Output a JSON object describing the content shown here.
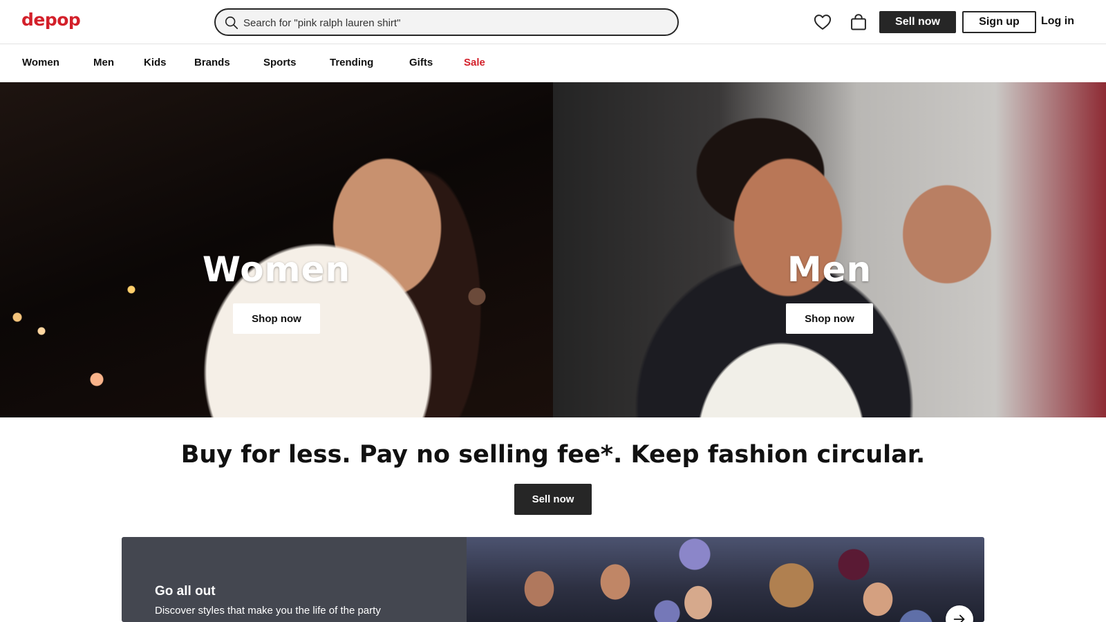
{
  "header": {
    "logo": "depop",
    "search_placeholder": "Search for \"pink ralph lauren shirt\"",
    "sell_label": "Sell now",
    "signup_label": "Sign up",
    "login_label": "Log in",
    "icons": [
      "search-icon",
      "heart-icon",
      "bag-icon"
    ]
  },
  "nav": {
    "items": [
      {
        "label": "Women"
      },
      {
        "label": "Men"
      },
      {
        "label": "Kids"
      },
      {
        "label": "Brands"
      },
      {
        "label": "Sports"
      },
      {
        "label": "Trending"
      },
      {
        "label": "Gifts"
      },
      {
        "label": "Sale"
      }
    ],
    "sale_color": "#d3202a"
  },
  "hero": {
    "women": {
      "title": "Women",
      "cta": "Shop now"
    },
    "men": {
      "title": "Men",
      "cta": "Shop now"
    }
  },
  "tagline": {
    "text": "Buy for less. Pay no selling fee*. Keep fashion circular.",
    "cta": "Sell now"
  },
  "promo": {
    "title": "Go all out",
    "subtitle": "Discover styles that make you the life of the party",
    "arrow_icon": "arrow-right-icon"
  },
  "colors": {
    "brand": "#d3202a",
    "dark_button": "#262626",
    "promo_panel": "#444750"
  }
}
